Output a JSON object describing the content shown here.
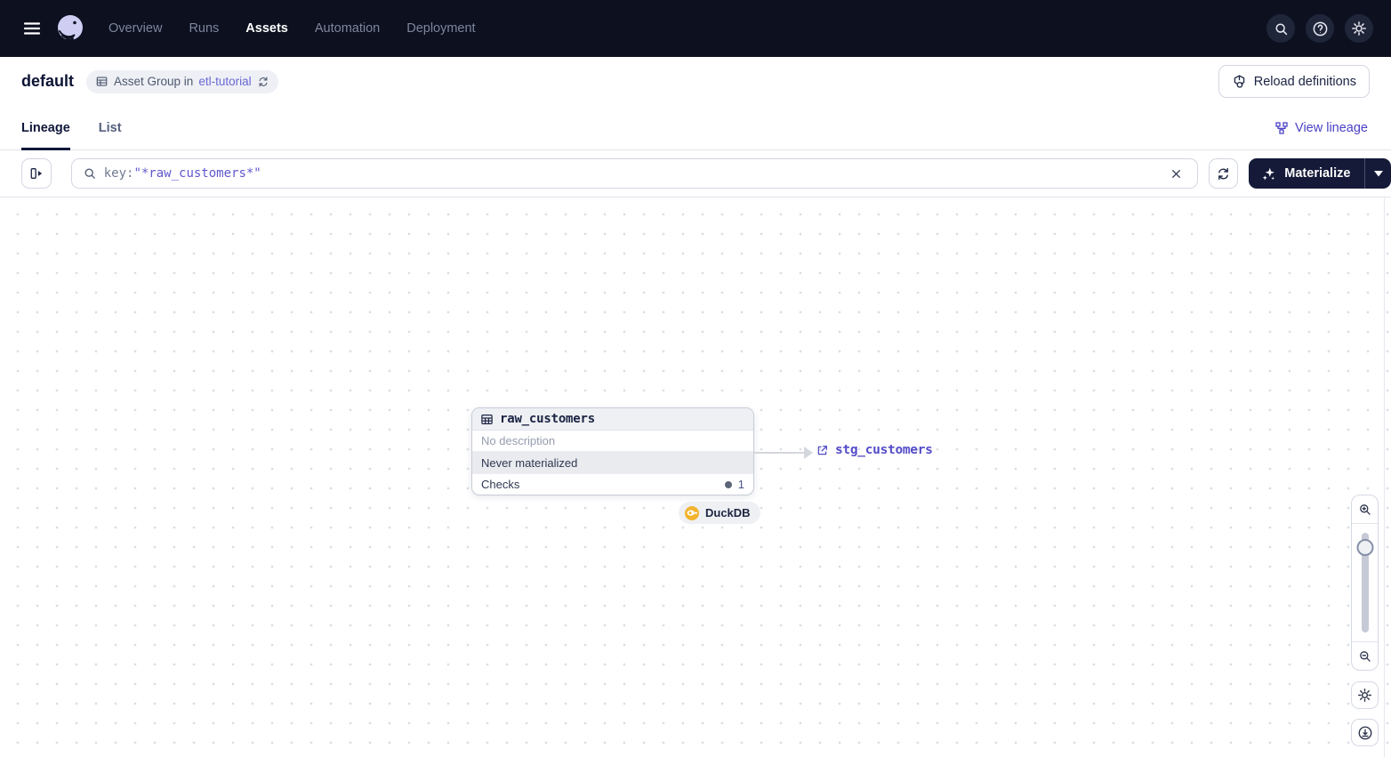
{
  "nav": {
    "items": [
      {
        "label": "Overview",
        "active": false
      },
      {
        "label": "Runs",
        "active": false
      },
      {
        "label": "Assets",
        "active": true
      },
      {
        "label": "Automation",
        "active": false
      },
      {
        "label": "Deployment",
        "active": false
      }
    ]
  },
  "header": {
    "title": "default",
    "badge_text": "Asset Group in",
    "badge_link": "etl-tutorial",
    "reload_label": "Reload definitions"
  },
  "tabs": {
    "lineage": "Lineage",
    "list": "List",
    "view_lineage": "View lineage"
  },
  "toolbar": {
    "search_prefix": "key:",
    "search_value": "\"*raw_customers*\"",
    "materialize_label": "Materialize"
  },
  "graph": {
    "node": {
      "title": "raw_customers",
      "description": "No description",
      "status": "Never materialized",
      "checks_label": "Checks",
      "checks_count": "1",
      "kind_label": "DuckDB"
    },
    "downstream_label": "stg_customers"
  },
  "colors": {
    "navbar_bg": "#0c101f",
    "accent_link": "#544cc9",
    "materialize_bg": "#141a38",
    "duckdb_yellow": "#f2b32f",
    "status_row_bg": "#e9ebef",
    "canvas_dot": "#dcdee6"
  }
}
